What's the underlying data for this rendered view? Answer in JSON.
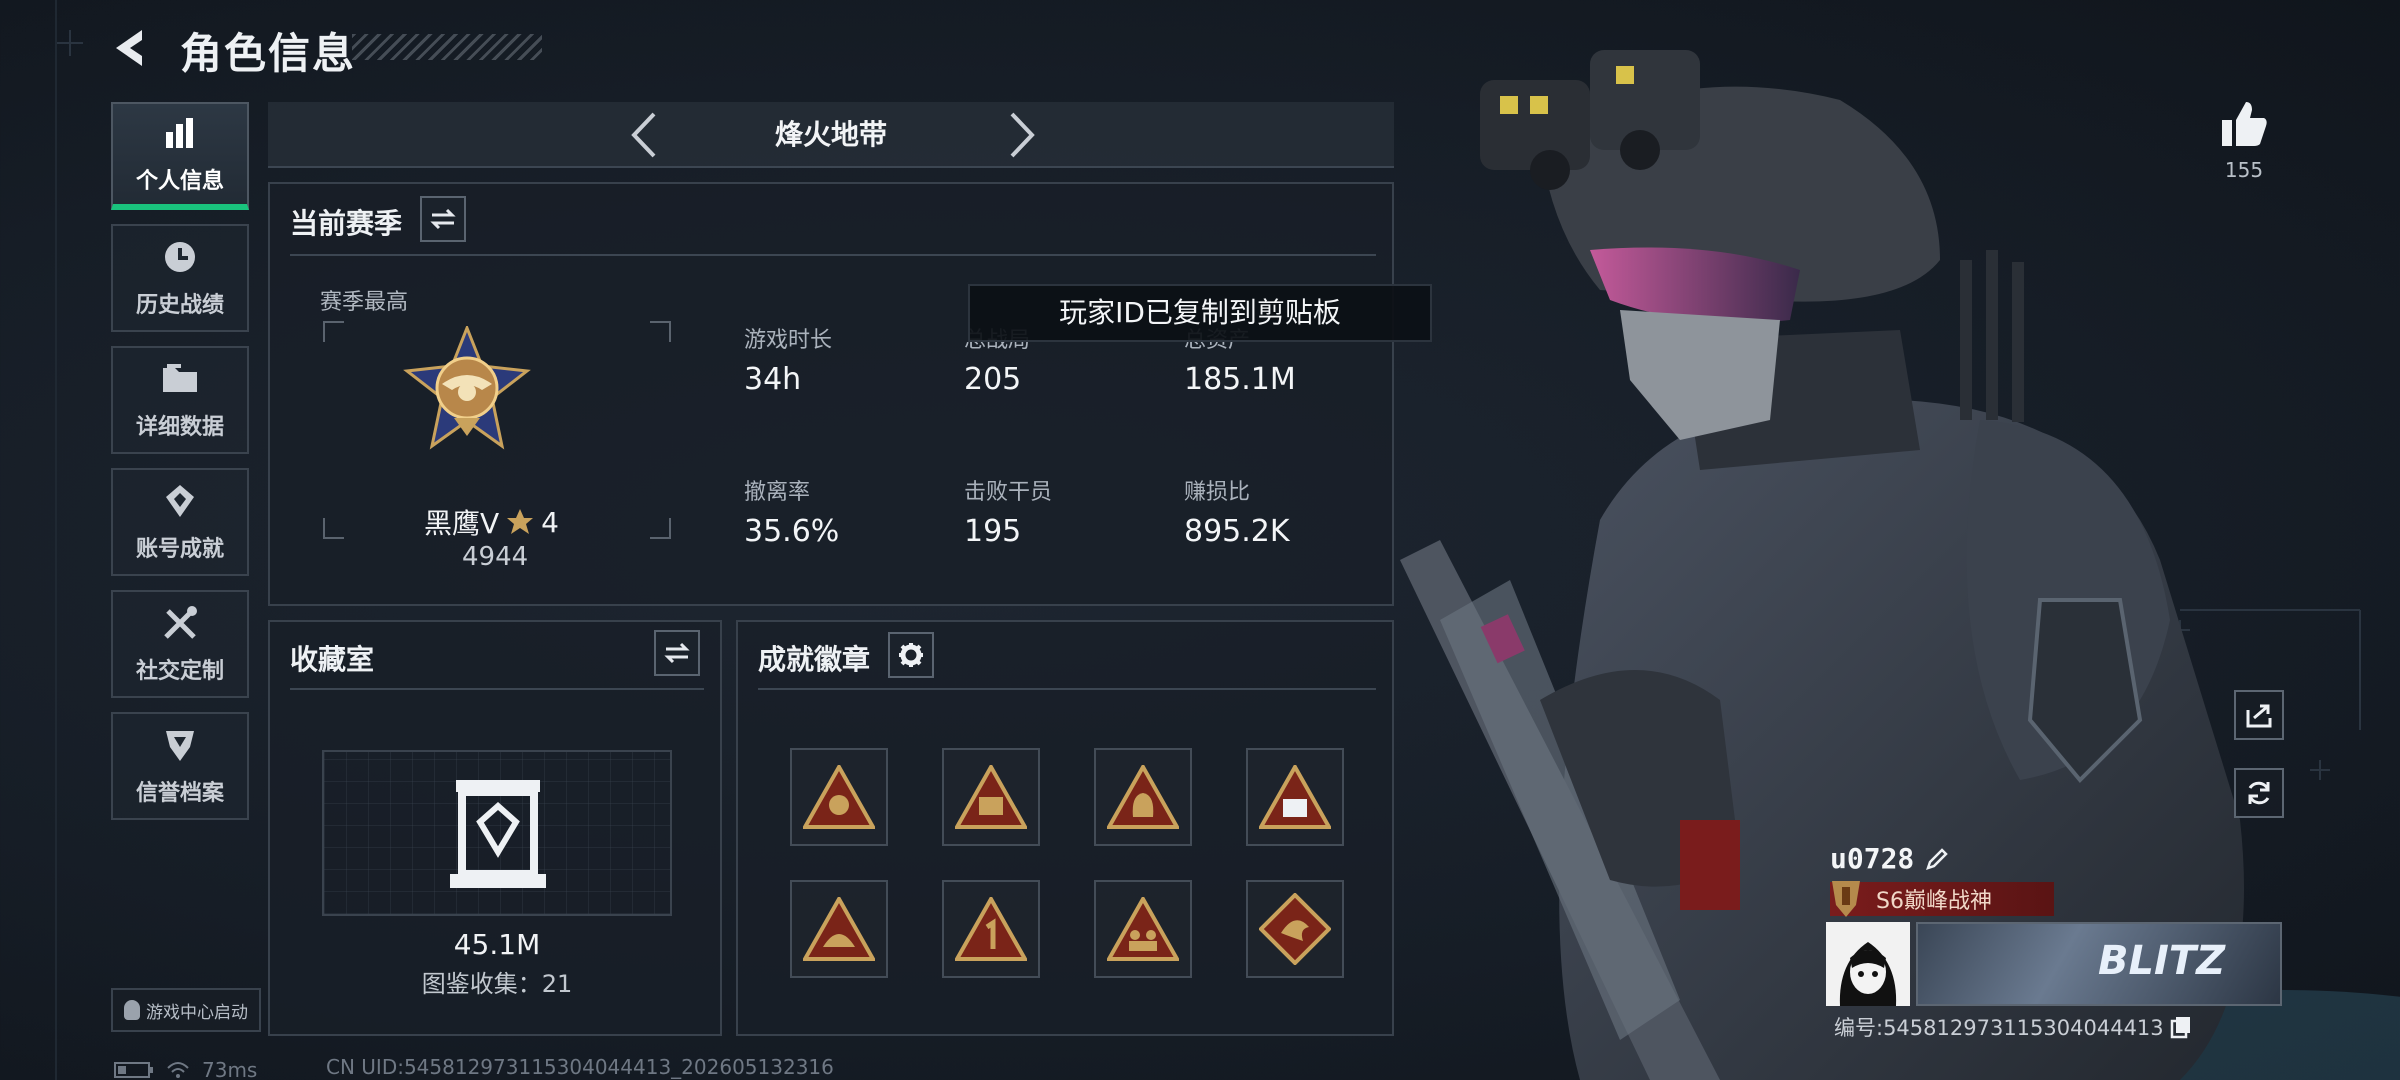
{
  "header": {
    "title": "角色信息"
  },
  "nav": {
    "items": [
      {
        "label": "个人信息",
        "icon": "bar-chart-icon",
        "active": true
      },
      {
        "label": "历史战绩",
        "icon": "clock-icon"
      },
      {
        "label": "详细数据",
        "icon": "folder-icon"
      },
      {
        "label": "账号成就",
        "icon": "achievement-icon"
      },
      {
        "label": "社交定制",
        "icon": "tools-icon"
      },
      {
        "label": "信誉档案",
        "icon": "shield-badge-icon"
      }
    ],
    "game_center_label": "游戏中心启动"
  },
  "mode": {
    "title": "烽火地带"
  },
  "season": {
    "title": "当前赛季",
    "highest_label": "赛季最高",
    "rank_name": "黑鹰V",
    "rank_stars": "4",
    "rank_points": "4944",
    "stats": [
      {
        "label": "游戏时长",
        "value": "34h"
      },
      {
        "label": "总战局",
        "value": "205"
      },
      {
        "label": "总资产",
        "value": "185.1M"
      },
      {
        "label": "撤离率",
        "value": "35.6%"
      },
      {
        "label": "击败干员",
        "value": "195"
      },
      {
        "label": "赚损比",
        "value": "895.2K"
      }
    ]
  },
  "toast": {
    "text": "玩家ID已复制到剪贴板"
  },
  "collection": {
    "title": "收藏室",
    "value": "45.1M",
    "catalog_label": "图鉴收集：21"
  },
  "badges": {
    "title": "成就徽章",
    "items": [
      "badge-eagle-icon",
      "badge-crest-icon",
      "badge-bag-icon",
      "badge-s6-icon",
      "badge-fortress-icon",
      "badge-number-one-icon",
      "badge-squad-icon",
      "badge-dragon-icon"
    ]
  },
  "profile": {
    "likes": "155",
    "username": "u0728",
    "title_badge": "S6巅峰战神",
    "player_id": "编号:545812973115304044413",
    "banner_text": "BLITZ"
  },
  "footer": {
    "ping": "73ms",
    "uid": "CN UID:545812973115304044413_202605132316"
  },
  "colors": {
    "accent_green": "#19c37d",
    "badge_red": "#7a1c1c",
    "gold": "#c9a25c"
  }
}
